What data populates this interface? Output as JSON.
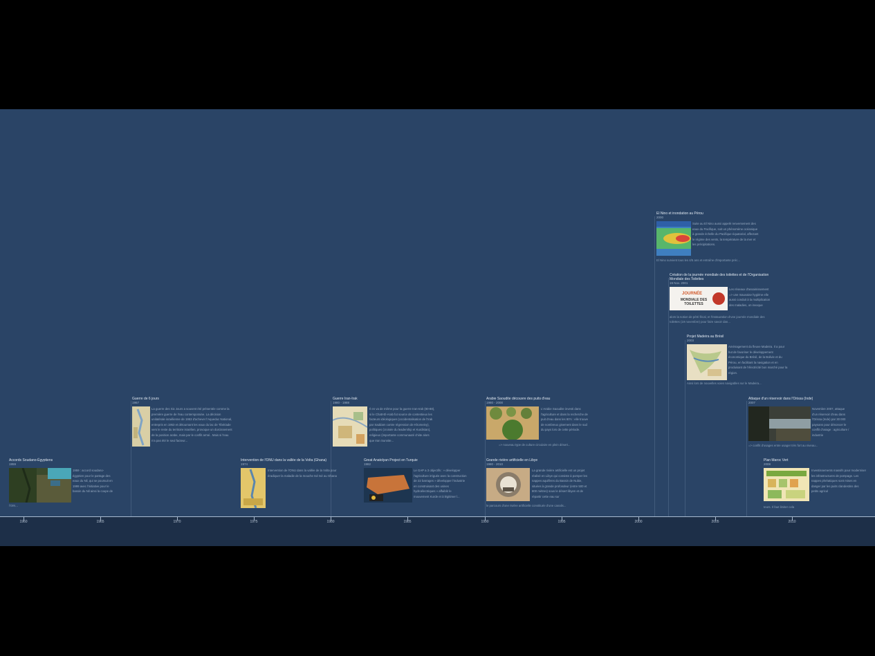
{
  "timeline": {
    "ticks": [
      "1960",
      "1965",
      "1970",
      "1975",
      "1980",
      "1985",
      "1990",
      "1995",
      "2000",
      "2005",
      "2010"
    ],
    "events": [
      {
        "title": "Accords Soudano-Égyptiens",
        "date": "1959",
        "text": "1959 : accord soudano-égyptien pour le partage des eaux du Nil, qui se poursuit en 1999 avec l'initiative pour le bassin du Nil ainsi la coupe de",
        "foot": "l'OIN..."
      },
      {
        "title": "Guerre de 6 jours",
        "date": "1967",
        "text": "La guerre des Six Jours a souvent été présentée comme la première guerre de l'eau contemporaine. La décision unilatérale israélienne de 1953 d'achever l'Aqueduc National, entrepris en 1953 et détournant les eaux du lac de Tibériade vers le reste du territoire israélien, provoque un durcissement de la position arabe, mais par le conflit armé.. Mais si l'eau n'a pas été le seul facteur...",
        "foot": ""
      },
      {
        "title": "Intervention de l'ONU dans la vallée de la Volta (Ghana)",
        "date": "1974",
        "text": "Intervention de l'ONU dans la vallée de la Volta pour éradiquer la maladie de la mouche tsé tsé au Ghana",
        "foot": ""
      },
      {
        "title": "Guerre Iran-Irak",
        "date": "1980 - 1988",
        "text": "Il en va de même pour la guerre Iran-Irak (80-88), si le Chatt-El-Arab fut source de contentieux les facteurs idéologiques (occidentalisation de l'Irak par Saddam contre régression de Khomeiny), politiques (croisée du leadership et Kurdistan), religieux (importante communauté chiite alors que Iran Sunnite...",
        "foot": ""
      },
      {
        "title": "Great Anatolyan Project en Turquie",
        "date": "1982",
        "text": "Le GAP a 3 objectifs : » développer l'agriculture irriguée avec la construction de 22 barrages » développer l'industrie en construisant des usines hydroélectriques » affaiblir le mouvement Kurde et à légitimer l...",
        "foot": ""
      },
      {
        "title": "Arabie Saoudite découvre des puits d'eau",
        "date": "1980 - 2000",
        "text": "L'Arabie Saoudite investi dans l'agriculture et dans la recherche de puit d'eau dans les 80's : elle trouve de nombreux gisement dans le sud du pays lors de cette période.",
        "foot": "=> nouveau type de culture circulaire en plein désert..."
      },
      {
        "title": "Grande rivière artificielle en Libye",
        "date": "1980 - 2010",
        "text": "La grande rivière artificielle est un projet réalisé en Libye qui consiste à pomper les nappes aquifères du Bassin de Nubie, situées à grande profondeur (entre 500 et 800 mètres) sous le désert libyen et de répartir cette eau sur",
        "foot": "le parcours d'une rivière artificielle constituée d'une canalis..."
      },
      {
        "title": "El Nino et inondation au Pérou",
        "date": "2000",
        "text": "Suite au El Nino aussi appelé renversement des eaux du Pacifique, soit un phénomène océanique à grande échelle du Pacifique équatorial, affectant le régime des vents, la température de la mer et les précipitations.",
        "foot": "El Nino survient tous les 4/5 ans et entraîne d'importante préc..."
      },
      {
        "title": "Création de la journée mondiale des toilettes et de l'Organisation Mondiale des Toilettes",
        "date": "19 Nov. 2001",
        "text": "Les réseaux d'assainissement => une mauvaise hygiène elle aussi conduit à la multiplication des maladies, on invoque",
        "foot": "alors la notion de pétri fécal, et l'instauration d'une journée mondiale des toilettes (19 novembre) pour faire savoir dan...",
        "logo_top": "JOURNÉE",
        "logo_bottom": "MONDIALE DES TOILETTES"
      },
      {
        "title": "Projet Madeira au Brésil",
        "date": "2003",
        "text": "Aménagement du fleuve Madeira. Il a pour but de favoriser le développement économique du Brésil, de la Bolivie et du Pérou, en facilitant la navigation et en produisant de l'électricité bon marché pour la région.",
        "foot": "Ainsi lors de nouvelles voies navigables sur le Madeira..."
      },
      {
        "title": "Attaque d'un réservoir dans l'Orissa (Inde)",
        "date": "2007",
        "text": "Novembre 2007, attaque d'un réservoir d'eau dans l'Orissa (Inde) par 30 000 paysans pour dénoncer le conflit d'usage : agriculture / industrie",
        "foot": "=> conflit d'usages entre usager très fort au niveau..."
      },
      {
        "title": "Plan Maroc Vert",
        "date": "2008",
        "text": "Investissements massifs pour moderniser les infrastructures de pompage. Les nappes phréatiques sont mises en danger par les puits clandestins des petits agricul",
        "foot": "teurs. Il faut limiter cela"
      }
    ]
  },
  "colors": {
    "background": "#2a4466",
    "axis_band": "#1d2f48",
    "letterbox": "#000000"
  }
}
